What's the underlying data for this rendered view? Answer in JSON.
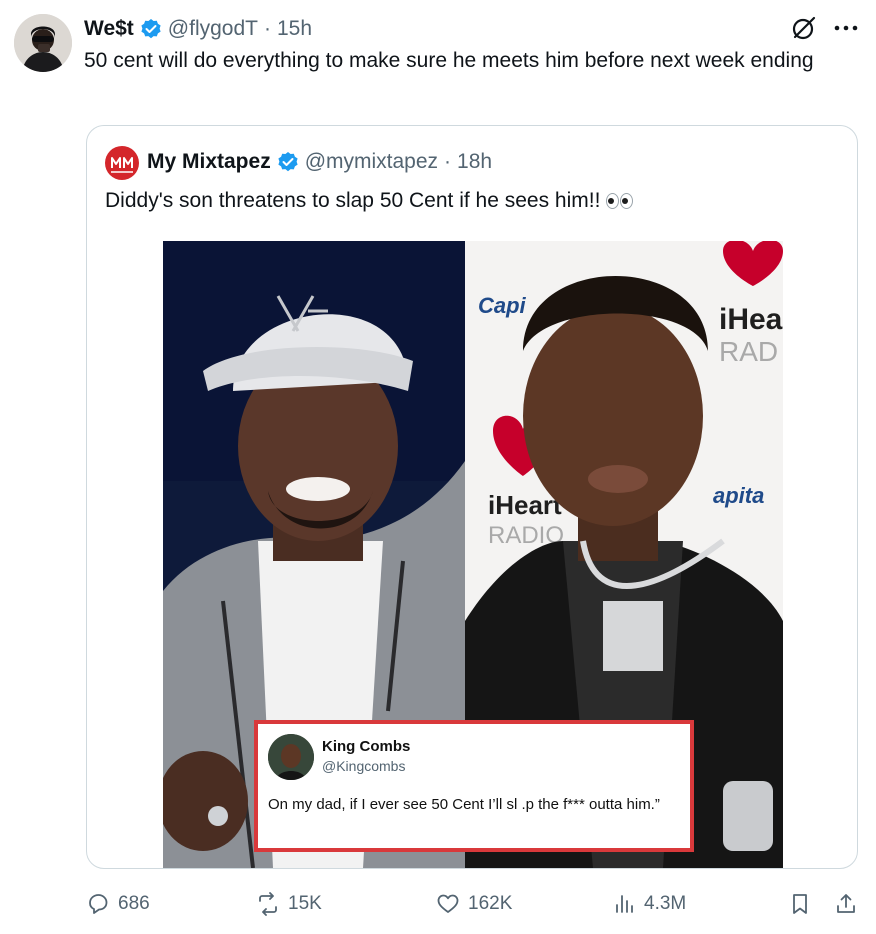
{
  "tweet": {
    "author_name": "We$t",
    "handle": "@flygodT",
    "separator": "·",
    "time": "15h",
    "text": "50 cent will do everything to make sure he meets him before next week ending"
  },
  "quote": {
    "author_name": "My Mixtapez",
    "handle": "@mymixtapez",
    "separator": "·",
    "time": "18h",
    "text": "Diddy's son threatens to slap 50 Cent if he sees him!!",
    "emoji": "eyes-emoji",
    "avatar_logo": "MM",
    "media": {
      "backdrop_texts": [
        "Capi",
        "iHea",
        "RAD",
        "iHeart",
        "RADIO",
        "apita"
      ],
      "embedded_post": {
        "name": "King Combs",
        "handle": "@Kingcombs",
        "text": "On my dad, if I ever see 50 Cent I’ll sl  .p the f*** outta him.”"
      }
    }
  },
  "actions": {
    "replies": "686",
    "reposts": "15K",
    "likes": "162K",
    "views": "4.3M"
  },
  "icons": {
    "verified": "verified-badge-icon",
    "grok": "grok-icon",
    "more": "more-icon",
    "reply": "reply-icon",
    "repost": "repost-icon",
    "like": "like-icon",
    "views": "views-icon",
    "bookmark": "bookmark-icon",
    "share": "share-icon"
  },
  "colors": {
    "verified": "#1d9bf0",
    "muted": "#536471",
    "border": "#cfd9de",
    "embed_border": "#d9393b",
    "iheart_red": "#c6002b"
  }
}
